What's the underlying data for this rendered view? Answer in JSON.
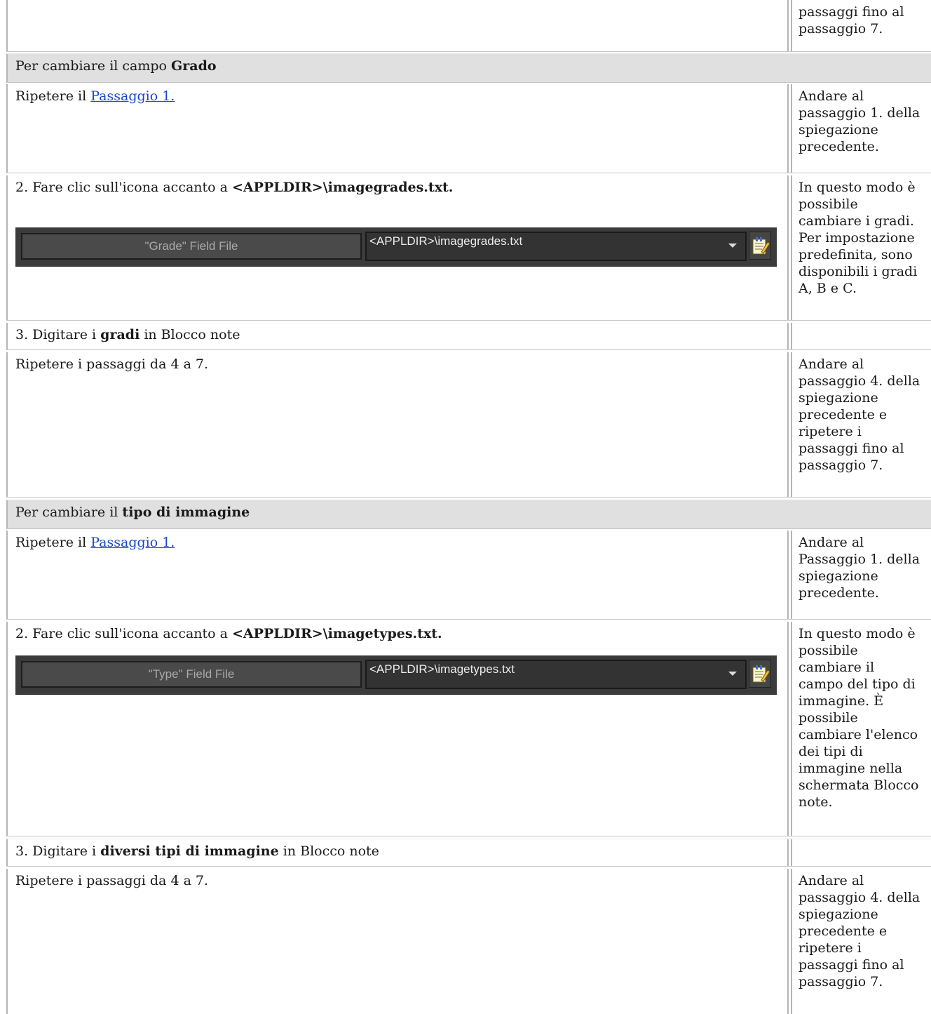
{
  "rows": {
    "top_side": "passaggi fino al\npassaggio 7.",
    "grade_header": {
      "prefix": "Per cambiare il campo ",
      "bold": "Grado"
    },
    "grade_step1": {
      "prefix": "Ripetere il ",
      "link": "Passaggio 1.",
      "side": "Andare al\npassaggio 1. della\nspiegazione\nprecedente."
    },
    "grade_step2": {
      "prefix": "2. Fare clic sull'icona accanto a ",
      "bold": "<APPLDIR>\\imagegrades.txt.",
      "widget_label": "\"Grade\" Field File",
      "widget_value": "<APPLDIR>\\imagegrades.txt",
      "side": "In questo modo è\npossibile\ncambiare i gradi.\nPer impostazione\npredefinita, sono\ndisponibili i gradi\nA, B e C."
    },
    "grade_step3": {
      "prefix": "3. Digitare i ",
      "bold": "gradi",
      "suffix": " in Blocco note"
    },
    "grade_repeat": {
      "text": "Ripetere i passaggi da 4 a 7.",
      "side": "Andare al\npassaggio 4. della\nspiegazione\nprecedente e\nripetere i\npassaggi fino al\npassaggio 7."
    },
    "type_header": {
      "prefix": "Per cambiare il ",
      "bold": "tipo di immagine"
    },
    "type_step1": {
      "prefix": "Ripetere il ",
      "link": "Passaggio 1.",
      "side": "Andare al\nPassaggio 1. della\nspiegazione\nprecedente."
    },
    "type_step2": {
      "prefix": "2. Fare clic sull'icona accanto a ",
      "bold": "<APPLDIR>\\imagetypes.txt.",
      "widget_label": "\"Type\" Field File",
      "widget_value": "<APPLDIR>\\imagetypes.txt",
      "side": "In questo modo è\npossibile\ncambiare il\ncampo del tipo di\nimmagine. È\npossibile\ncambiare l'elenco\ndei tipi di\nimmagine nella\nschermata Blocco\nnote."
    },
    "type_step3": {
      "prefix": "3. Digitare i ",
      "bold": "diversi tipi di immagine",
      "suffix": " in Blocco note"
    },
    "type_repeat": {
      "text": "Ripetere i passaggi da 4 a 7.",
      "side": "Andare al\npassaggio 4. della\nspiegazione\nprecedente e\nripetere i\npassaggi fino al\npassaggio 7."
    }
  },
  "icons": {
    "widget_button": "notepad-edit-icon",
    "dropdown": "dropdown-arrow-icon"
  },
  "colors": {
    "link": "#1747c9",
    "header_bg": "#e0e0e0",
    "widget_bg": "#3b3b3b"
  }
}
